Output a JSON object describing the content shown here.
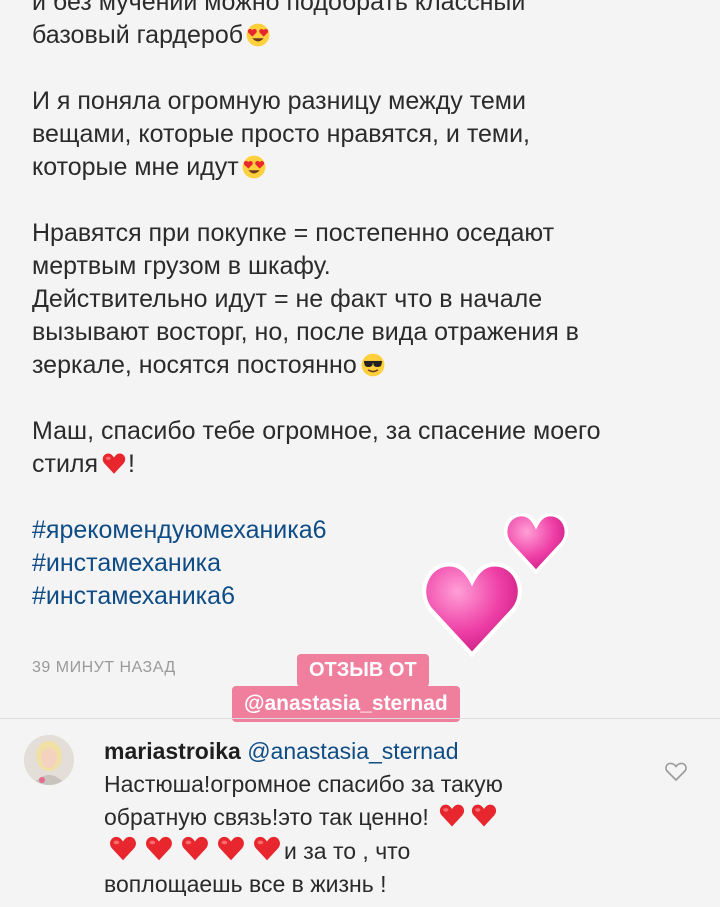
{
  "caption": {
    "paragraphs": [
      {
        "lines": [
          "и без мучений можно подобрать классный",
          "базовый гардероб"
        ],
        "trailing_emoji": "heart-eyes-emoji"
      },
      {
        "lines": [
          "И я поняла огромную разницу между теми",
          "вещами, которые просто нравятся, и теми,",
          "которые мне  идут"
        ],
        "trailing_emoji": "heart-eyes-emoji"
      },
      {
        "lines": [
          "Нравятся при покупке = постепенно оседают",
          "мертвым грузом в шкафу.",
          "Действительно идут = не факт что в начале",
          "вызывают восторг, но, после вида отражения в",
          "зеркале, носятся постоянно"
        ],
        "trailing_emoji": "sunglasses-emoji"
      },
      {
        "lines": [
          "Маш, спасибо тебе огромное, за спасение моего",
          "стиля"
        ],
        "trailing_emoji": "red-heart-emoji",
        "trailing_text": "!"
      }
    ],
    "hashtags": [
      "#ярекомендуюмеханика6",
      "#инстамеханика",
      "#инстамеханика6"
    ]
  },
  "timestamp": "39 МИНУТ НАЗАД",
  "sticker": {
    "line1": "ОТЗЫВ ОТ",
    "line2": "@anastasia_sternad",
    "color": "#f07f9e",
    "hearts": "pink-hearts-sticker"
  },
  "comment": {
    "username": "mariastroika",
    "mention": "@anastasia_sternad",
    "line1": "Настюша!огромное спасибо за такую",
    "line2": "обратную связь!это так ценно!",
    "line3_text": "и за то , что",
    "line4": "воплощаешь все в жизнь !",
    "hearts_line2": 2,
    "hearts_line3": 5
  },
  "colors": {
    "background": "#f4f4f4",
    "hashtag": "#0f4c86",
    "heart_red": "#e8262e",
    "heart_pink": "#ee3fa6"
  }
}
